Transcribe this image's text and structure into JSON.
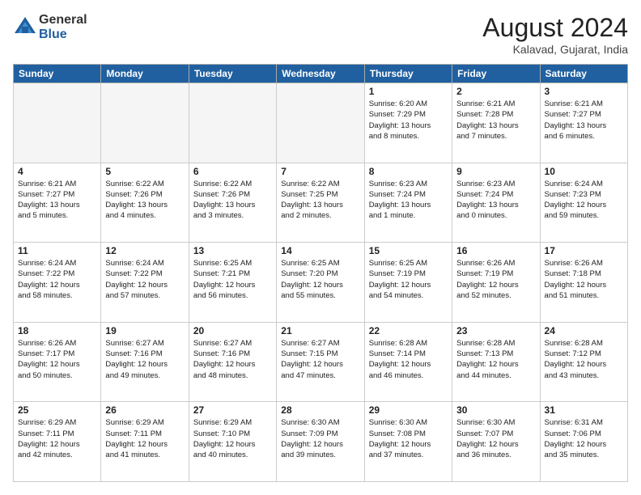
{
  "logo": {
    "general": "General",
    "blue": "Blue"
  },
  "title": "August 2024",
  "location": "Kalavad, Gujarat, India",
  "days_header": [
    "Sunday",
    "Monday",
    "Tuesday",
    "Wednesday",
    "Thursday",
    "Friday",
    "Saturday"
  ],
  "weeks": [
    [
      {
        "num": "",
        "info": ""
      },
      {
        "num": "",
        "info": ""
      },
      {
        "num": "",
        "info": ""
      },
      {
        "num": "",
        "info": ""
      },
      {
        "num": "1",
        "info": "Sunrise: 6:20 AM\nSunset: 7:29 PM\nDaylight: 13 hours\nand 8 minutes."
      },
      {
        "num": "2",
        "info": "Sunrise: 6:21 AM\nSunset: 7:28 PM\nDaylight: 13 hours\nand 7 minutes."
      },
      {
        "num": "3",
        "info": "Sunrise: 6:21 AM\nSunset: 7:27 PM\nDaylight: 13 hours\nand 6 minutes."
      }
    ],
    [
      {
        "num": "4",
        "info": "Sunrise: 6:21 AM\nSunset: 7:27 PM\nDaylight: 13 hours\nand 5 minutes."
      },
      {
        "num": "5",
        "info": "Sunrise: 6:22 AM\nSunset: 7:26 PM\nDaylight: 13 hours\nand 4 minutes."
      },
      {
        "num": "6",
        "info": "Sunrise: 6:22 AM\nSunset: 7:26 PM\nDaylight: 13 hours\nand 3 minutes."
      },
      {
        "num": "7",
        "info": "Sunrise: 6:22 AM\nSunset: 7:25 PM\nDaylight: 13 hours\nand 2 minutes."
      },
      {
        "num": "8",
        "info": "Sunrise: 6:23 AM\nSunset: 7:24 PM\nDaylight: 13 hours\nand 1 minute."
      },
      {
        "num": "9",
        "info": "Sunrise: 6:23 AM\nSunset: 7:24 PM\nDaylight: 13 hours\nand 0 minutes."
      },
      {
        "num": "10",
        "info": "Sunrise: 6:24 AM\nSunset: 7:23 PM\nDaylight: 12 hours\nand 59 minutes."
      }
    ],
    [
      {
        "num": "11",
        "info": "Sunrise: 6:24 AM\nSunset: 7:22 PM\nDaylight: 12 hours\nand 58 minutes."
      },
      {
        "num": "12",
        "info": "Sunrise: 6:24 AM\nSunset: 7:22 PM\nDaylight: 12 hours\nand 57 minutes."
      },
      {
        "num": "13",
        "info": "Sunrise: 6:25 AM\nSunset: 7:21 PM\nDaylight: 12 hours\nand 56 minutes."
      },
      {
        "num": "14",
        "info": "Sunrise: 6:25 AM\nSunset: 7:20 PM\nDaylight: 12 hours\nand 55 minutes."
      },
      {
        "num": "15",
        "info": "Sunrise: 6:25 AM\nSunset: 7:19 PM\nDaylight: 12 hours\nand 54 minutes."
      },
      {
        "num": "16",
        "info": "Sunrise: 6:26 AM\nSunset: 7:19 PM\nDaylight: 12 hours\nand 52 minutes."
      },
      {
        "num": "17",
        "info": "Sunrise: 6:26 AM\nSunset: 7:18 PM\nDaylight: 12 hours\nand 51 minutes."
      }
    ],
    [
      {
        "num": "18",
        "info": "Sunrise: 6:26 AM\nSunset: 7:17 PM\nDaylight: 12 hours\nand 50 minutes."
      },
      {
        "num": "19",
        "info": "Sunrise: 6:27 AM\nSunset: 7:16 PM\nDaylight: 12 hours\nand 49 minutes."
      },
      {
        "num": "20",
        "info": "Sunrise: 6:27 AM\nSunset: 7:16 PM\nDaylight: 12 hours\nand 48 minutes."
      },
      {
        "num": "21",
        "info": "Sunrise: 6:27 AM\nSunset: 7:15 PM\nDaylight: 12 hours\nand 47 minutes."
      },
      {
        "num": "22",
        "info": "Sunrise: 6:28 AM\nSunset: 7:14 PM\nDaylight: 12 hours\nand 46 minutes."
      },
      {
        "num": "23",
        "info": "Sunrise: 6:28 AM\nSunset: 7:13 PM\nDaylight: 12 hours\nand 44 minutes."
      },
      {
        "num": "24",
        "info": "Sunrise: 6:28 AM\nSunset: 7:12 PM\nDaylight: 12 hours\nand 43 minutes."
      }
    ],
    [
      {
        "num": "25",
        "info": "Sunrise: 6:29 AM\nSunset: 7:11 PM\nDaylight: 12 hours\nand 42 minutes."
      },
      {
        "num": "26",
        "info": "Sunrise: 6:29 AM\nSunset: 7:11 PM\nDaylight: 12 hours\nand 41 minutes."
      },
      {
        "num": "27",
        "info": "Sunrise: 6:29 AM\nSunset: 7:10 PM\nDaylight: 12 hours\nand 40 minutes."
      },
      {
        "num": "28",
        "info": "Sunrise: 6:30 AM\nSunset: 7:09 PM\nDaylight: 12 hours\nand 39 minutes."
      },
      {
        "num": "29",
        "info": "Sunrise: 6:30 AM\nSunset: 7:08 PM\nDaylight: 12 hours\nand 37 minutes."
      },
      {
        "num": "30",
        "info": "Sunrise: 6:30 AM\nSunset: 7:07 PM\nDaylight: 12 hours\nand 36 minutes."
      },
      {
        "num": "31",
        "info": "Sunrise: 6:31 AM\nSunset: 7:06 PM\nDaylight: 12 hours\nand 35 minutes."
      }
    ]
  ]
}
